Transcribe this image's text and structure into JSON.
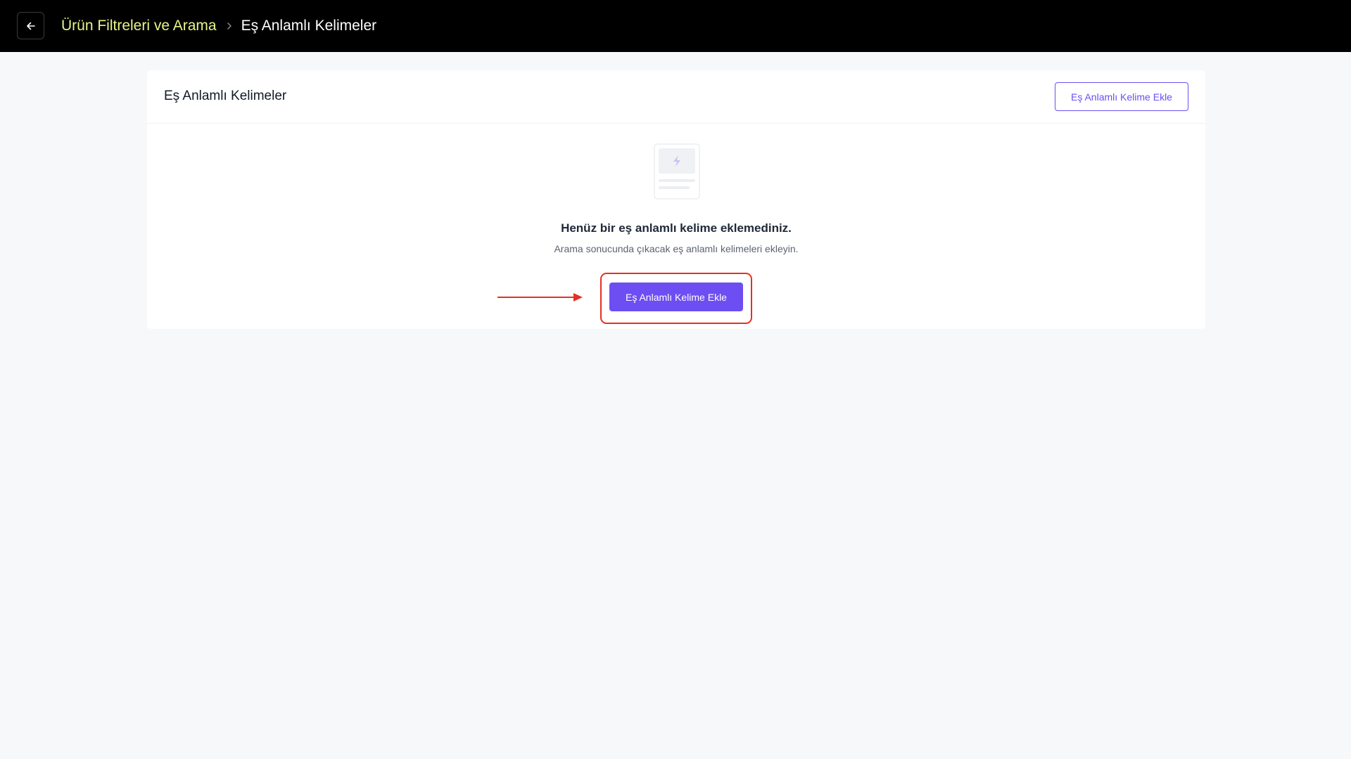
{
  "header": {
    "breadcrumb": {
      "parent": "Ürün Filtreleri ve Arama",
      "current": "Eş Anlamlı Kelimeler"
    },
    "icons": {
      "back": "arrow-left-icon",
      "separator": "chevron-right-icon"
    }
  },
  "card": {
    "title": "Eş Anlamlı Kelimeler",
    "header_button_label": "Eş Anlamlı Kelime Ekle",
    "empty_state": {
      "icon": "empty-document-icon",
      "title": "Henüz bir eş anlamlı kelime eklemediniz.",
      "subtitle": "Arama sonucunda çıkacak eş anlamlı kelimeleri ekleyin.",
      "button_label": "Eş Anlamlı Kelime Ekle"
    }
  },
  "annotation": {
    "arrow_color": "#e53122",
    "highlight_color": "#e53122"
  },
  "colors": {
    "accent": "#6c4ef2",
    "topbar": "#000000",
    "breadcrumb_link": "#e8f58a",
    "background": "#f7f8fa"
  }
}
